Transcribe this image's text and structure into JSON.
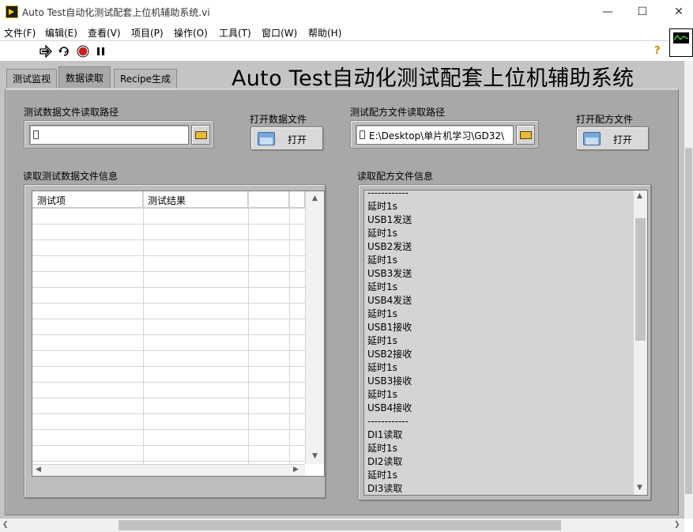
{
  "window": {
    "title": "Auto Test自动化测试配套上位机辅助系统.vi",
    "minimize_glyph": "—",
    "maximize_glyph": "☐",
    "close_glyph": "✕"
  },
  "menu": [
    "文件(F)",
    "编辑(E)",
    "查看(V)",
    "项目(P)",
    "操作(O)",
    "工具(T)",
    "窗口(W)",
    "帮助(H)"
  ],
  "toolbar": {
    "icons": [
      "run-arrow-icon",
      "run-continuously-icon",
      "abort-icon",
      "pause-icon"
    ],
    "help_glyph": "?"
  },
  "tabs": [
    {
      "label": "测试监视",
      "active": false
    },
    {
      "label": "数据读取",
      "active": true
    },
    {
      "label": "Recipe生成",
      "active": false
    }
  ],
  "panel_title": "Auto Test自动化测试配套上位机辅助系统",
  "data_file": {
    "path_label": "测试数据文件读取路径",
    "path_value": "",
    "open_label": "打开数据文件",
    "open_button": "打开",
    "info_label": "读取测试数据文件信息",
    "columns": [
      "测试项",
      "测试结果",
      ""
    ]
  },
  "recipe_file": {
    "path_label": "测试配方文件读取路径",
    "path_value": "E:\\Desktop\\单片机学习\\GD32\\",
    "open_label": "打开配方文件",
    "open_button": "打开",
    "info_label": "读取配方文件信息",
    "lines": [
      "------------",
      "延时1s",
      "USB1发送",
      "延时1s",
      "USB2发送",
      "延时1s",
      "USB3发送",
      "延时1s",
      "USB4发送",
      "延时1s",
      "USB1接收",
      "延时1s",
      "USB2接收",
      "延时1s",
      "USB3接收",
      "延时1s",
      "USB4接收",
      "------------",
      "DI1读取",
      "延时1s",
      "DI2读取",
      "延时1s",
      "DI3读取"
    ]
  },
  "colors": {
    "panel_bg": "#c4c4c4",
    "tab_page_bg": "#a8a8a8",
    "control_frame": "#bdbdbd",
    "list_bg": "#d4d4d4"
  }
}
